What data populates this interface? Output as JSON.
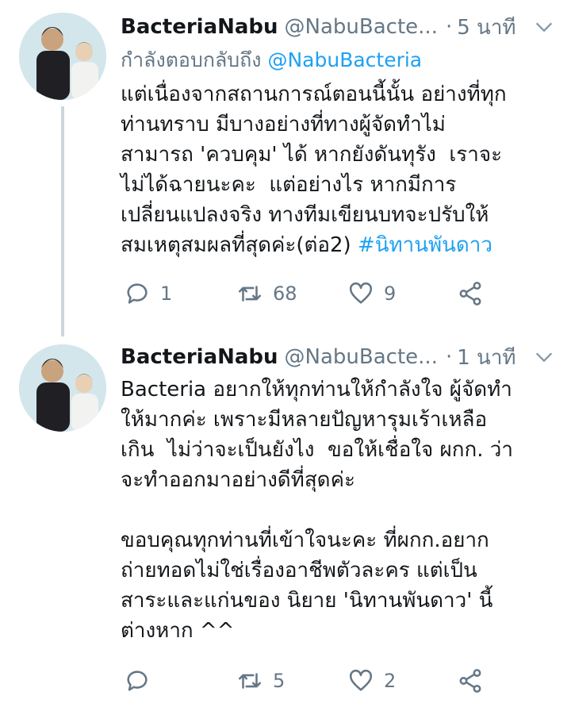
{
  "tweets": [
    {
      "name": "BacteriaNabu",
      "handle": "@NabuBacte...",
      "dot": "·",
      "time": "5 นาที",
      "replying_prefix": "กำลังตอบกลับถึง",
      "replying_to": "@NabuBacteria",
      "text": "แต่เนื่องจากสถานการณ์ตอนนี้นั้น อย่างที่ทุก\nท่านทราบ มีบางอย่างที่ทางผู้จัดทำไม่\nสามารถ 'ควบคุม' ได้ หากยังดันทุรัง  เราจะ\nไม่ได้ฉายนะคะ  แต่อย่างไร หากมีการ\nเปลี่ยนแปลงจริง ทางทีมเขียนบทจะปรับให้\nสมเหตุสมผลที่สุดค่ะ(ต่อ2) ",
      "hashtag": "#นิทานพันดาว",
      "reply_count": "1",
      "retweet_count": "68",
      "like_count": "9",
      "icons": {
        "reply": "reply-icon",
        "retweet": "retweet-icon",
        "like": "heart-icon",
        "share": "share-icon",
        "menu": "chevron-down-icon"
      }
    },
    {
      "name": "BacteriaNabu",
      "handle": "@NabuBacte...",
      "dot": "·",
      "time": "1 นาที",
      "text": "Bacteria อยากให้ทุกท่านให้กำลังใจ ผู้จัดทำ\nให้มากค่ะ เพราะมีหลายปัญหารุมเร้าเหลือ\nเกิน  ไม่ว่าจะเป็นยังไง  ขอให้เชื่อใจ ผกก. ว่า\nจะทำออกมาอย่างดีที่สุดค่ะ\n\nขอบคุณทุกท่านที่เข้าใจนะคะ ที่ผกก.อยาก\nถ่ายทอดไม่ใช่เรื่องอาชีพตัวละคร แต่เป็น\nสาระและแก่นของ นิยาย 'นิทานพันดาว' นี้\nต่างหาก ^^",
      "reply_count": "",
      "retweet_count": "5",
      "like_count": "2"
    }
  ],
  "colors": {
    "link": "#1da1f2",
    "secondary": "#657786",
    "text": "#14171a",
    "thread_line": "#ccd6dd"
  }
}
